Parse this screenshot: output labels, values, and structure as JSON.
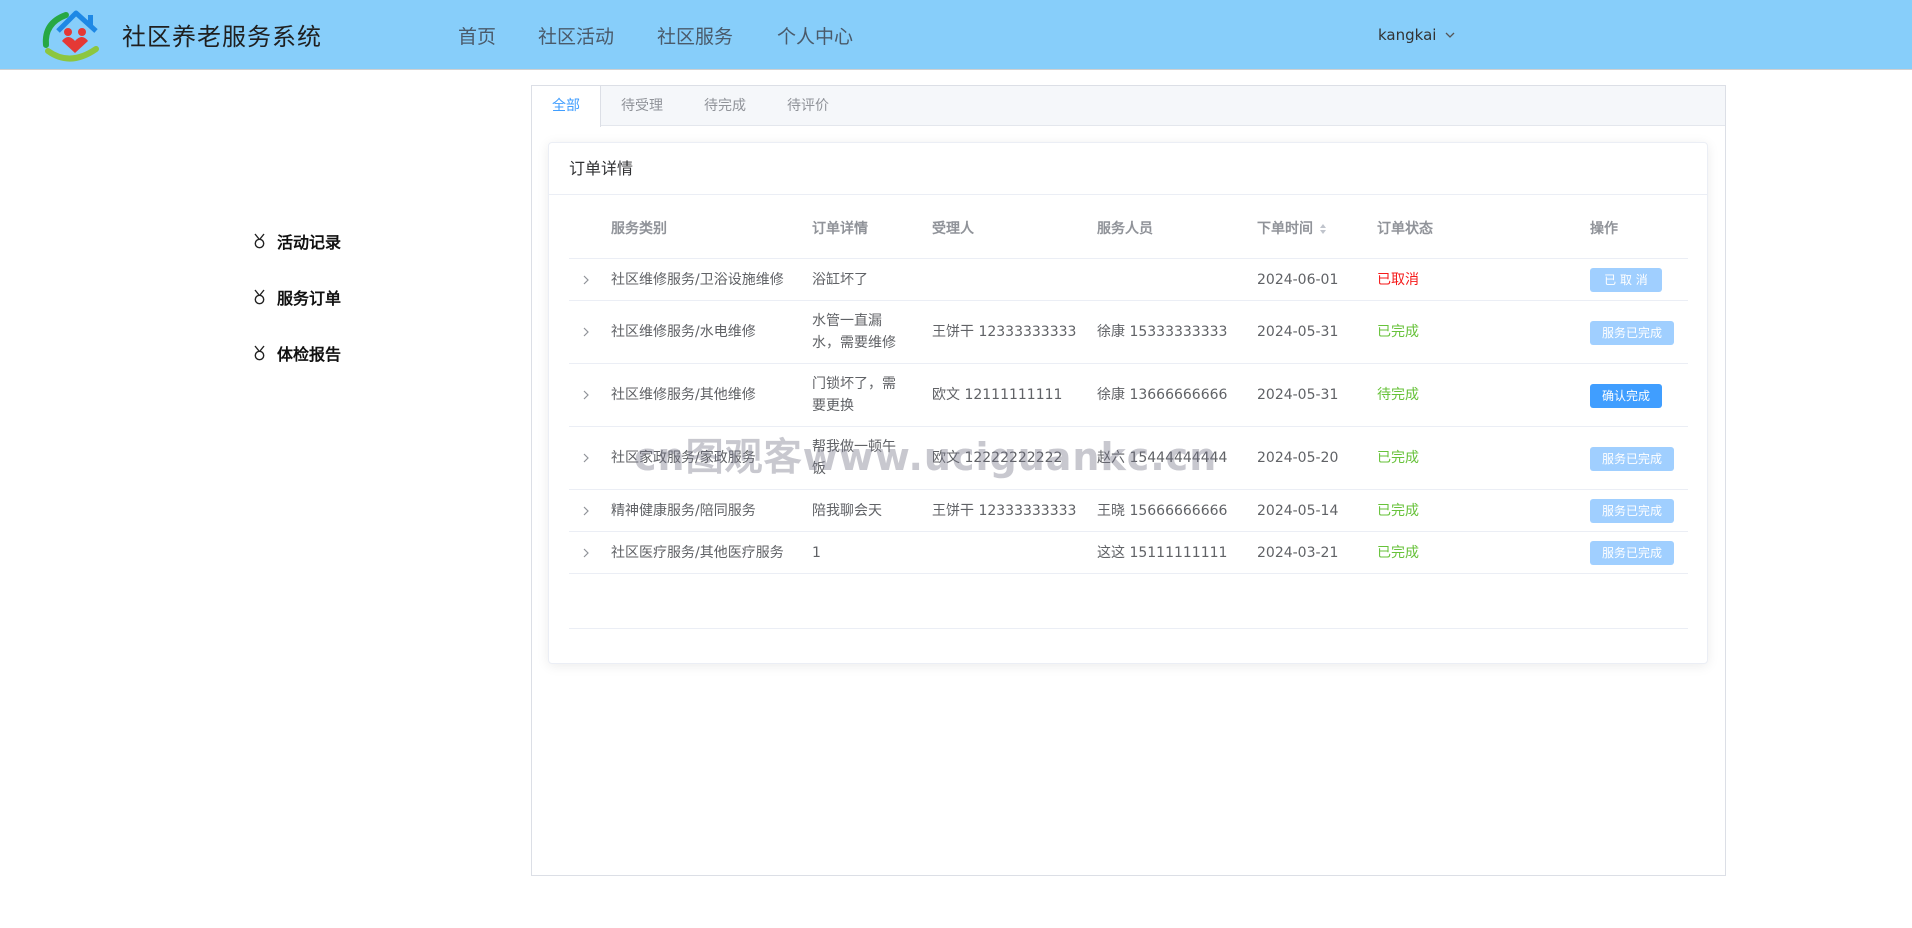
{
  "header": {
    "app_title": "社区养老服务系统",
    "nav": [
      "首页",
      "社区活动",
      "社区服务",
      "个人中心"
    ],
    "user": "kangkai",
    "bg_color": "#87cefa"
  },
  "sidebar": {
    "items": [
      {
        "label": "活动记录",
        "icon": "medal-icon"
      },
      {
        "label": "服务订单",
        "icon": "medal-icon"
      },
      {
        "label": "体检报告",
        "icon": "medal-icon"
      }
    ]
  },
  "tabs": [
    "全部",
    "待受理",
    "待完成",
    "待评价"
  ],
  "active_tab": "全部",
  "card": {
    "title": "订单详情"
  },
  "table": {
    "columns": [
      "服务类别",
      "订单详情",
      "受理人",
      "服务人员",
      "下单时间",
      "订单状态",
      "操作"
    ],
    "rows": [
      {
        "category": "社区维修服务/卫浴设施维修",
        "detail": "浴缸坏了",
        "handler": "",
        "staff": "",
        "time": "2024-06-01",
        "status": "已取消",
        "action": "已 取 消"
      },
      {
        "category": "社区维修服务/水电维修",
        "detail": "水管一直漏水，需要维修",
        "handler": "王饼干 12333333333",
        "staff": "徐康 15333333333",
        "time": "2024-05-31",
        "status": "已完成",
        "action": "服务已完成"
      },
      {
        "category": "社区维修服务/其他维修",
        "detail": "门锁坏了，需要更换",
        "handler": "欧文 12111111111",
        "staff": "徐康 13666666666",
        "time": "2024-05-31",
        "status": "待完成",
        "action": "确认完成"
      },
      {
        "category": "社区家政服务/家政服务",
        "detail": "帮我做一顿午饭",
        "handler": "欧文 12222222222",
        "staff": "赵六 15444444444",
        "time": "2024-05-20",
        "status": "已完成",
        "action": "服务已完成"
      },
      {
        "category": "精神健康服务/陪同服务",
        "detail": "陪我聊会天",
        "handler": "王饼干 12333333333",
        "staff": "王晓 15666666666",
        "time": "2024-05-14",
        "status": "已完成",
        "action": "服务已完成"
      },
      {
        "category": "社区医疗服务/其他医疗服务",
        "detail": "1",
        "handler": "",
        "staff": "这这 15111111111",
        "time": "2024-03-21",
        "status": "已完成",
        "action": "服务已完成"
      }
    ]
  },
  "watermark": "cn图观客www.uciguankc.cn",
  "colors": {
    "accent": "#409eff",
    "accent_disabled": "#a0cfff",
    "status_cancel": "#f51a1a",
    "status_done": "#67c23a"
  }
}
